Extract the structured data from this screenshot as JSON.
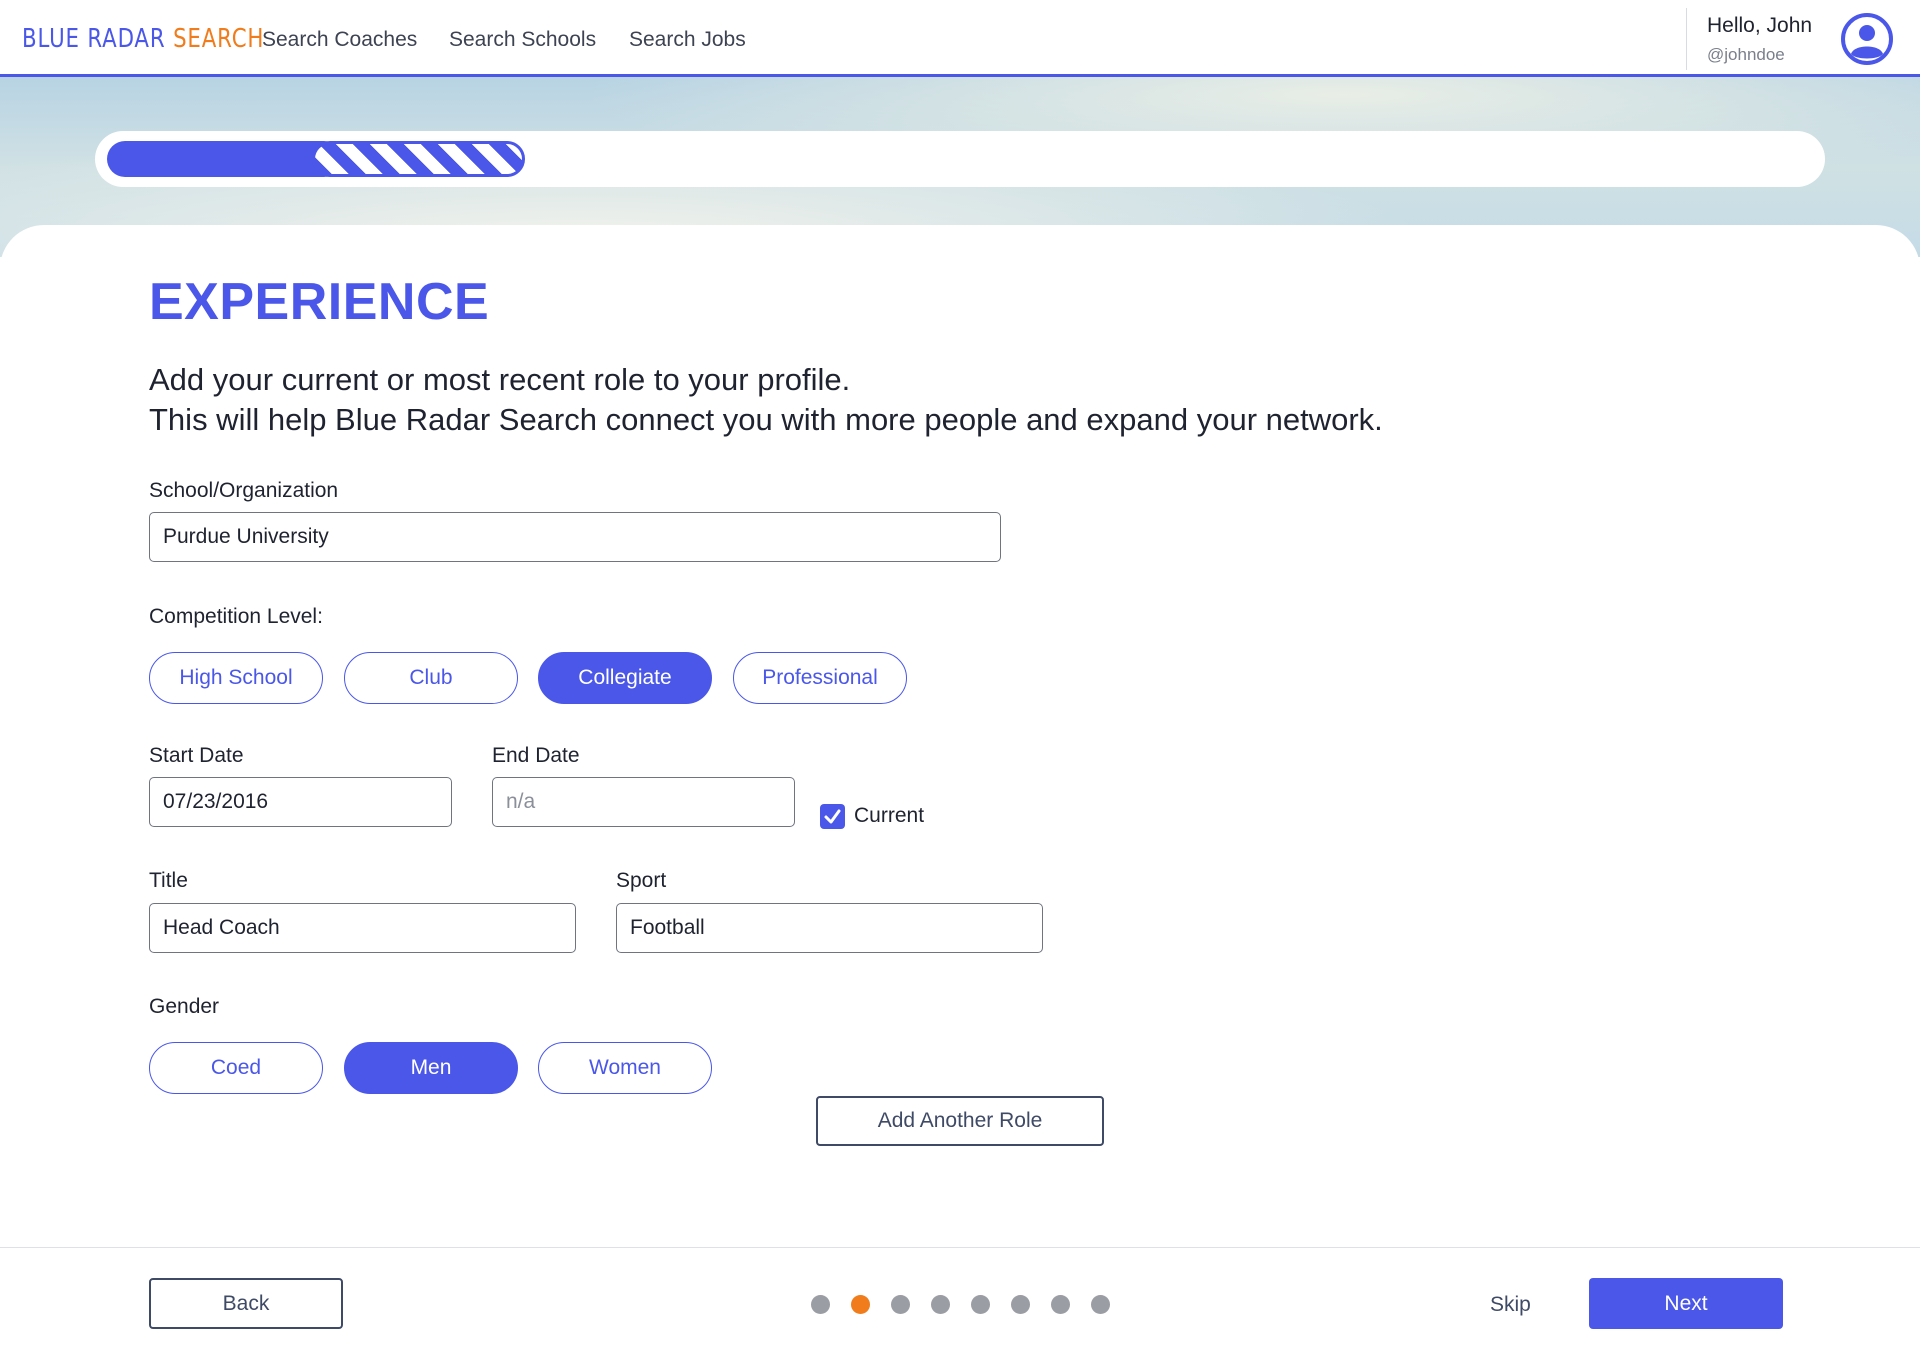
{
  "header": {
    "logo_part1": "BLUE RADAR ",
    "logo_part2": "SEARCH",
    "nav": [
      {
        "label": "Search Coaches"
      },
      {
        "label": "Search Schools"
      },
      {
        "label": "Search Jobs"
      }
    ],
    "user": {
      "greeting": "Hello, John",
      "handle": "@johndoe",
      "avatar_icon": "user-circle-icon"
    }
  },
  "progress": {
    "completed_fraction": 0.12,
    "in_progress_fraction": 0.125
  },
  "page": {
    "title": "EXPERIENCE",
    "intro_line1": "Add your current or most recent role to your profile.",
    "intro_line2": "This will help Blue Radar Search connect you with more people and expand your network."
  },
  "form": {
    "school": {
      "label": "School/Organization",
      "value": "Purdue University"
    },
    "competition": {
      "label": "Competition Level:",
      "options": [
        "High School",
        "Club",
        "Collegiate",
        "Professional"
      ],
      "selected": "Collegiate"
    },
    "start_date": {
      "label": "Start Date",
      "value": "07/23/2016"
    },
    "end_date": {
      "label": "End Date",
      "value": "",
      "placeholder": "n/a"
    },
    "current": {
      "label": "Current",
      "checked": true
    },
    "title": {
      "label": "Title",
      "value": "Head Coach"
    },
    "sport": {
      "label": "Sport",
      "value": "Football"
    },
    "gender": {
      "label": "Gender",
      "options": [
        "Coed",
        "Men",
        "Women"
      ],
      "selected": "Men"
    },
    "add_role_label": "Add Another Role"
  },
  "footer": {
    "back_label": "Back",
    "skip_label": "Skip",
    "next_label": "Next",
    "step_count": 8,
    "current_step": 2
  },
  "colors": {
    "primary": "#4a57e8",
    "accent": "#f07c1c",
    "muted_dot": "#9a9da4"
  }
}
